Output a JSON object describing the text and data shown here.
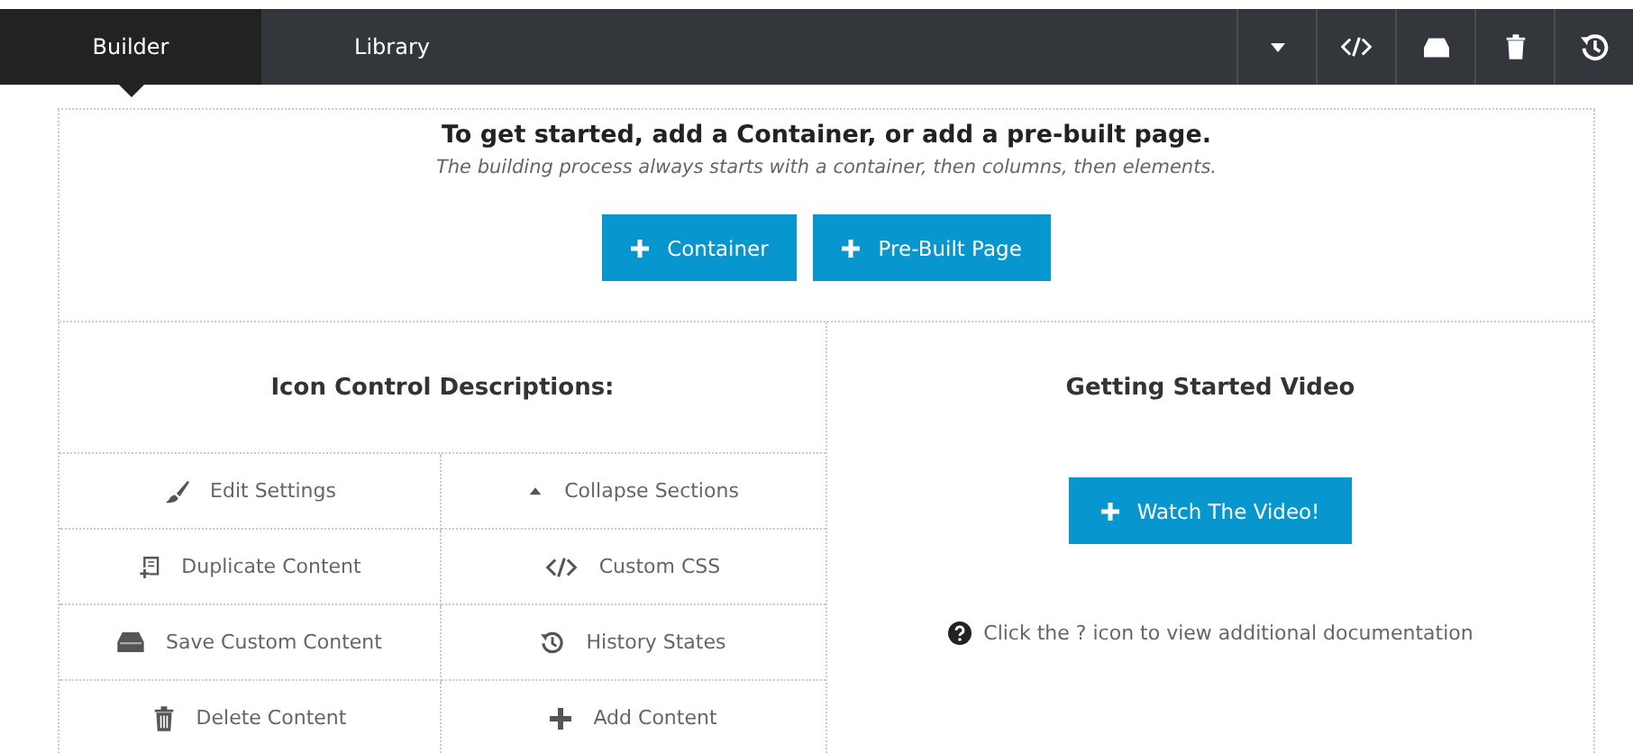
{
  "tabs": [
    {
      "label": "Builder",
      "selected": true
    },
    {
      "label": "Library",
      "selected": false
    }
  ],
  "toolbar": [
    {
      "kind": "caret"
    },
    {
      "kind": "code"
    },
    {
      "kind": "save"
    },
    {
      "kind": "trash"
    },
    {
      "kind": "history"
    }
  ],
  "intro": {
    "title": "To get started, add a Container, or add a pre-built page.",
    "subtitle": "The building process always starts with a container, then columns, then elements.",
    "buttons": [
      {
        "label": "Container"
      },
      {
        "label": "Pre-Built Page"
      }
    ]
  },
  "descriptions": {
    "heading": "Icon Control Descriptions:",
    "items": [
      {
        "kind": "brush",
        "label": "Edit Settings"
      },
      {
        "kind": "caret-up",
        "label": "Collapse Sections"
      },
      {
        "kind": "duplicate",
        "label": "Duplicate Content"
      },
      {
        "kind": "code",
        "label": "Custom CSS"
      },
      {
        "kind": "save",
        "label": "Save Custom Content"
      },
      {
        "kind": "history",
        "label": "History States"
      },
      {
        "kind": "trash",
        "label": "Delete Content"
      },
      {
        "kind": "plus",
        "label": "Add Content"
      }
    ]
  },
  "video": {
    "heading": "Getting Started Video",
    "button": "Watch The Video!",
    "note": "Click the ? icon to view additional documentation"
  }
}
